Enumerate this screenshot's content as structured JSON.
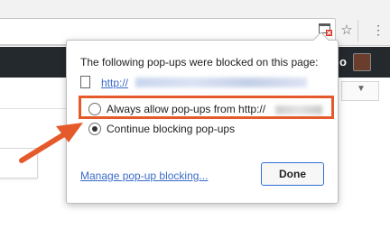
{
  "toolbar": {
    "popup_icon": "popup-blocked-icon",
    "star_icon": "star-icon",
    "menu_icon": "menu-icon"
  },
  "page": {
    "dark_bar_text": "o"
  },
  "bubble": {
    "title": "The following pop-ups were blocked on this page:",
    "blocked_link": "http://",
    "options": {
      "allow_label": "Always allow pop-ups from http://",
      "block_label": "Continue blocking pop-ups",
      "selected": "block"
    },
    "manage_link": "Manage pop-up blocking...",
    "done_label": "Done"
  },
  "colors": {
    "highlight": "#e55a2b",
    "link": "#3b6bc9",
    "button_border": "#2f6fd3"
  }
}
